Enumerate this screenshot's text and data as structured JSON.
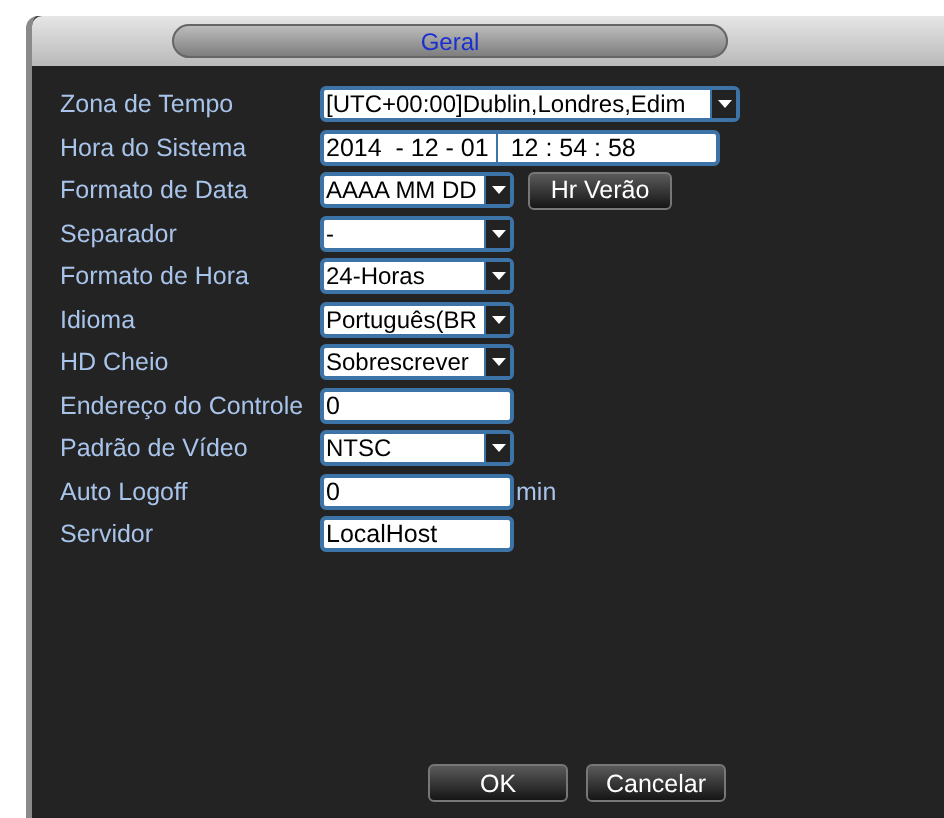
{
  "window": {
    "title": "Geral"
  },
  "rows": [
    {
      "label": "Zona de Tempo",
      "kind": "wide-select",
      "value": "[UTC+00:00]Dublin,Londres,Edim"
    },
    {
      "label": "Hora do Sistema",
      "kind": "datetime",
      "date": "2014  - 12 - 01",
      "time": "12 : 54 : 58"
    },
    {
      "label": "Formato de Data",
      "kind": "select",
      "value": "AAAA MM DD",
      "button": "Hr Verão"
    },
    {
      "label": "Separador",
      "kind": "select",
      "value": "-"
    },
    {
      "label": "Formato de Hora",
      "kind": "select",
      "value": "24-Horas"
    },
    {
      "label": "Idioma",
      "kind": "select",
      "value": "Português(BR"
    },
    {
      "label": "HD Cheio",
      "kind": "select",
      "value": "Sobrescrever"
    },
    {
      "label": "Endereço do Controle",
      "kind": "input",
      "value": "0"
    },
    {
      "label": "Padrão de Vídeo",
      "kind": "select",
      "value": "NTSC"
    },
    {
      "label": "Auto Logoff",
      "kind": "input",
      "value": "0",
      "suffix": "min"
    },
    {
      "label": "Servidor",
      "kind": "input",
      "value": "LocalHost"
    }
  ],
  "buttons": [
    "OK",
    "Cancelar"
  ]
}
